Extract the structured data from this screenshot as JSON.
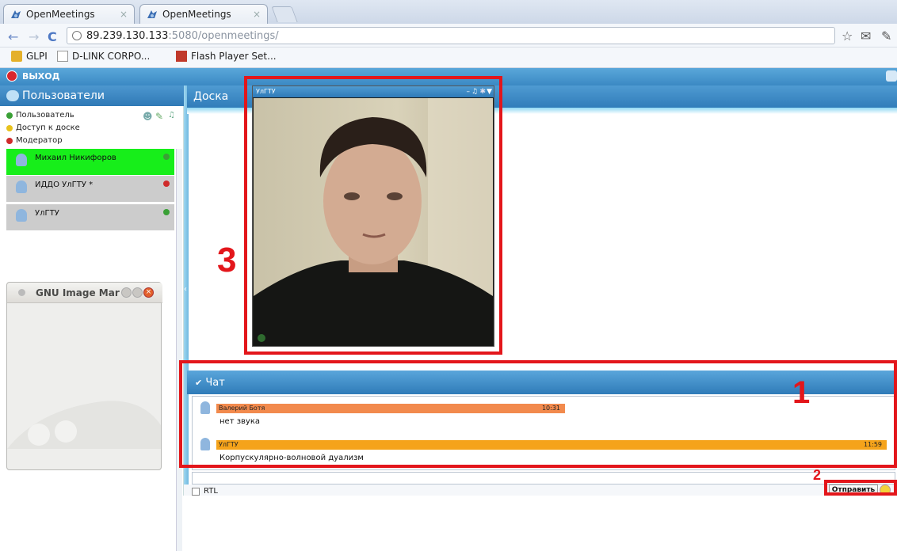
{
  "browser": {
    "tabs": [
      {
        "label": "OpenMeetings"
      },
      {
        "label": "OpenMeetings"
      }
    ],
    "url_host": "89.239.130.133",
    "url_rest": ":5080/openmeetings/",
    "bookmarks": [
      {
        "label": "GLPI"
      },
      {
        "label": "D-LINK CORPO..."
      },
      {
        "label": "Flash Player Set..."
      }
    ]
  },
  "app": {
    "exit_label": "ВЫХОД"
  },
  "users_panel": {
    "title": "Пользователи",
    "legend": [
      {
        "label": "Пользователь",
        "color": "#3aa036"
      },
      {
        "label": "Доступ к доске",
        "color": "#e8c21c"
      },
      {
        "label": "Модератор",
        "color": "#cf2b2b"
      }
    ],
    "users": [
      {
        "name": "Михаил Никифоров",
        "bg": "#17ee1a",
        "status_color": "#3aa036"
      },
      {
        "name": "ИДДО УлГТУ  *",
        "bg": "#cccccc",
        "status_color": "#cf2b2b"
      },
      {
        "name": "УлГТУ",
        "bg": "#cccccc",
        "status_color": "#3aa036"
      }
    ]
  },
  "gimp_window": {
    "title": "GNU Image Mar"
  },
  "whiteboard": {
    "title": "Доска"
  },
  "video": {
    "title": "УлГТУ"
  },
  "chat": {
    "title": "Чат",
    "messages": [
      {
        "author": "Валерий Ботя",
        "time": "10:31",
        "text": "нет звука",
        "bar_color": "#f28a4d"
      },
      {
        "author": "УлГТУ",
        "time": "11:59",
        "text": "Корпускулярно-волновой дуализм",
        "bar_color": "#f5a31a"
      }
    ],
    "rtl_label": "RTL",
    "send_label": "Отправить"
  },
  "annotations": {
    "labels": [
      "1",
      "2",
      "3"
    ],
    "color": "#e3161b"
  }
}
